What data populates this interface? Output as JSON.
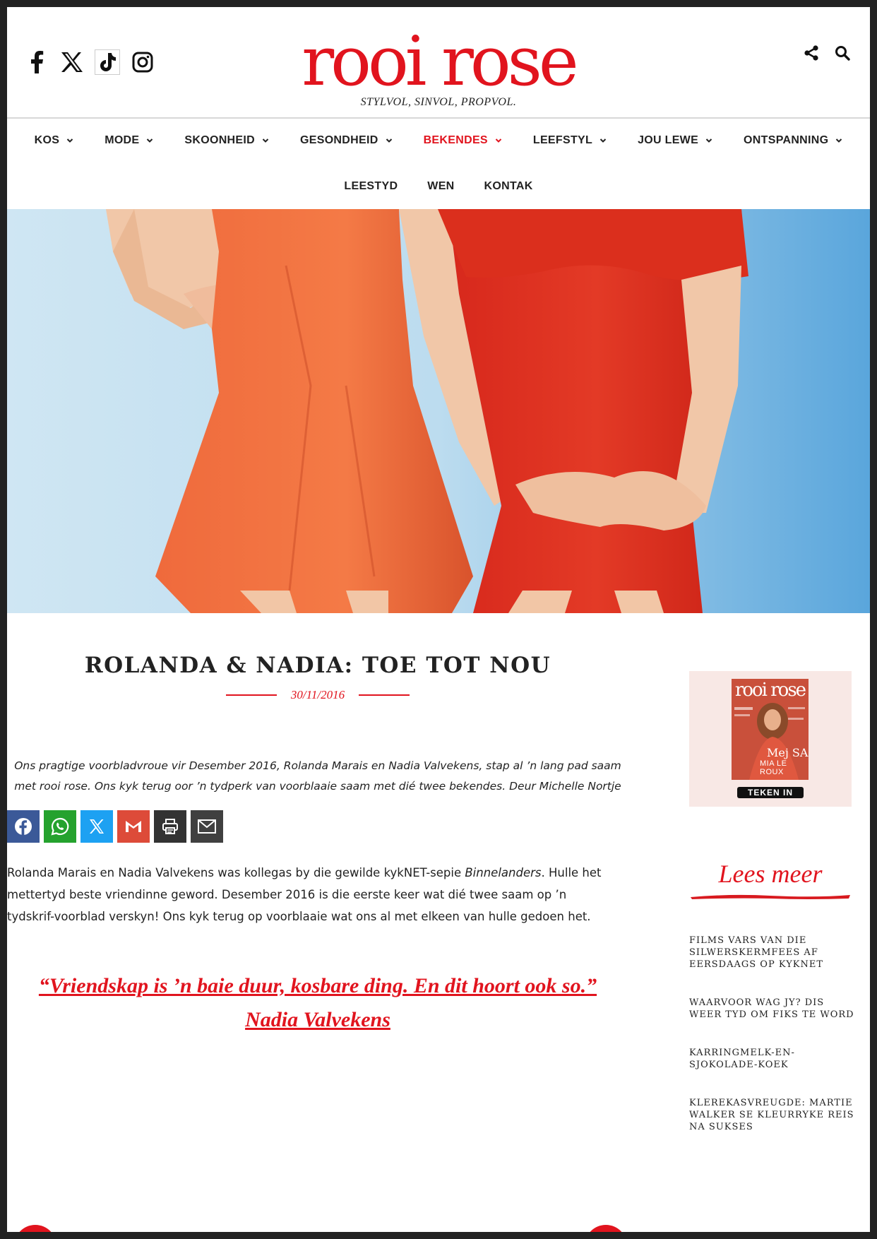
{
  "brand": {
    "logo": "rooi rose",
    "tagline": "STYLVOL, SINVOL, PROPVOL.",
    "accent": "#e1141e"
  },
  "social": [
    "facebook-icon",
    "x-icon",
    "tiktok-icon",
    "instagram-icon"
  ],
  "nav": {
    "row1": [
      {
        "label": "KOS"
      },
      {
        "label": "MODE"
      },
      {
        "label": "SKOONHEID"
      },
      {
        "label": "GESONDHEID"
      },
      {
        "label": "BEKENDES"
      },
      {
        "label": "LEEFSTYL"
      },
      {
        "label": "JOU LEWE"
      },
      {
        "label": "ONTSPANNING"
      }
    ],
    "row2": [
      {
        "label": "LEESTYD"
      },
      {
        "label": "WEN"
      },
      {
        "label": "KONTAK"
      }
    ]
  },
  "article": {
    "title": "ROLANDA & NADIA: TOE TOT NOU",
    "date": "30/11/2016",
    "intro": "Ons pragtige voorbladvroue vir Desember 2016, Rolanda Marais en Nadia Valvekens, stap al ’n lang pad saam met rooi rose. Ons kyk terug oor ’n tydperk van voorblaaie saam met dié twee bekendes. Deur Michelle Nortje",
    "body_pre": "Rolanda Marais en Nadia Valvekens was kollegas by die gewilde kykNET-sepie ",
    "body_em": "Binnelanders",
    "body_post": ". Hulle het mettertyd beste vriendinne geword. Desember 2016 is die eerste keer wat dié twee saam op ’n tydskrif-voorblad verskyn! Ons kyk terug op voorblaaie wat ons al met elkeen van hulle gedoen het.",
    "quote": "“Vriendskap is ’n baie duur, kosbare ding. En dit hoort ook so.” Nadia Valvekens"
  },
  "sidebar": {
    "cover": {
      "logo": "rooi rose",
      "name1": "Mej SA",
      "name2": "MIA LE ROUX",
      "button": "TEKEN IN"
    },
    "lees_title": "Lees meer",
    "lees_items": [
      "FILMS VARS VAN DIE SILWERSKERMFEES AF EERSDAAGS OP KYKNET",
      "WAARVOOR WAG JY? DIS WEER TYD OM FIKS TE WORD",
      "KARRINGMELK-EN-SJOKOLADE-KOEK",
      "KLEREKASVREUGDE: MARTIE WALKER SE KLEURRYKE REIS NA SUKSES"
    ]
  },
  "share_buttons": [
    {
      "icon": "facebook-icon",
      "color": "#3b5998"
    },
    {
      "icon": "whatsapp-icon",
      "color": "#25a22e"
    },
    {
      "icon": "x-icon",
      "color": "#1da1f2"
    },
    {
      "icon": "gmail-icon",
      "color": "#dd4b39"
    },
    {
      "icon": "print-icon",
      "color": "#333333"
    },
    {
      "icon": "email-icon",
      "color": "#404040"
    }
  ]
}
